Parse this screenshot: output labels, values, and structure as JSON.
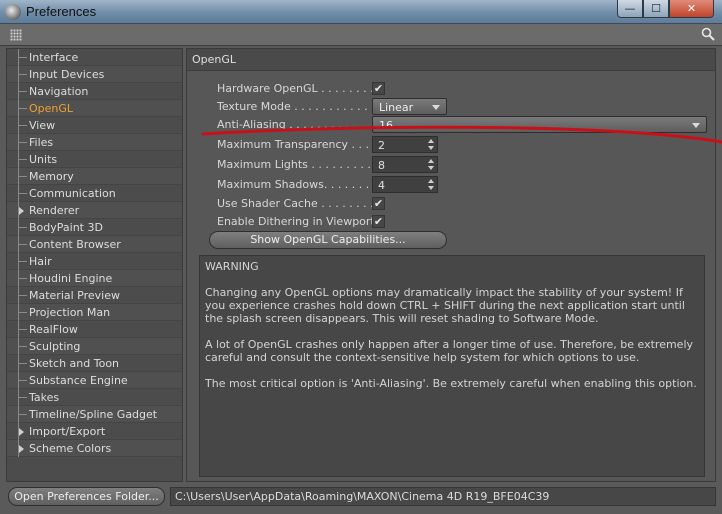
{
  "window": {
    "title": "Preferences",
    "close_glyph": "✕",
    "max_glyph": "☐",
    "min_glyph": "—"
  },
  "sidebar": {
    "items": [
      {
        "label": "Interface",
        "arrow": false,
        "active": false
      },
      {
        "label": "Input Devices",
        "arrow": false,
        "active": false
      },
      {
        "label": "Navigation",
        "arrow": false,
        "active": false
      },
      {
        "label": "OpenGL",
        "arrow": false,
        "active": true
      },
      {
        "label": "View",
        "arrow": false,
        "active": false
      },
      {
        "label": "Files",
        "arrow": false,
        "active": false
      },
      {
        "label": "Units",
        "arrow": false,
        "active": false
      },
      {
        "label": "Memory",
        "arrow": false,
        "active": false
      },
      {
        "label": "Communication",
        "arrow": false,
        "active": false
      },
      {
        "label": "Renderer",
        "arrow": true,
        "active": false
      },
      {
        "label": "BodyPaint 3D",
        "arrow": false,
        "active": false
      },
      {
        "label": "Content Browser",
        "arrow": false,
        "active": false
      },
      {
        "label": "Hair",
        "arrow": false,
        "active": false
      },
      {
        "label": "Houdini Engine",
        "arrow": false,
        "active": false
      },
      {
        "label": "Material Preview",
        "arrow": false,
        "active": false
      },
      {
        "label": "Projection Man",
        "arrow": false,
        "active": false
      },
      {
        "label": "RealFlow",
        "arrow": false,
        "active": false
      },
      {
        "label": "Sculpting",
        "arrow": false,
        "active": false
      },
      {
        "label": "Sketch and Toon",
        "arrow": false,
        "active": false
      },
      {
        "label": "Substance Engine",
        "arrow": false,
        "active": false
      },
      {
        "label": "Takes",
        "arrow": false,
        "active": false
      },
      {
        "label": "Timeline/Spline Gadget",
        "arrow": false,
        "active": false
      },
      {
        "label": "Import/Export",
        "arrow": true,
        "active": false
      },
      {
        "label": "Scheme Colors",
        "arrow": true,
        "active": false
      }
    ]
  },
  "main": {
    "header": "OpenGL",
    "hardware_opengl": {
      "label": "Hardware OpenGL . . . . . . . . . .",
      "checked": true
    },
    "texture_mode": {
      "label": "Texture Mode . . . . . . . . . . . . .",
      "value": "Linear"
    },
    "anti_aliasing": {
      "label": "Anti-Aliasing . . . . . . . . . . . . .",
      "value": "16"
    },
    "max_transparency": {
      "label": "Maximum Transparency . . . . .",
      "value": "2"
    },
    "max_lights": {
      "label": "Maximum Lights . . . . . . . . . . .",
      "value": "8"
    },
    "max_shadows": {
      "label": "Maximum Shadows. . . . . . . . .",
      "value": "4"
    },
    "use_shader_cache": {
      "label": "Use Shader Cache . . . . . . . . . .",
      "checked": true
    },
    "enable_dithering": {
      "label": "Enable Dithering in Viewport",
      "checked": true
    },
    "check_glyph": "✔",
    "caps_button": "Show OpenGL Capabilities...",
    "warning": {
      "title": "WARNING",
      "p1": "Changing any OpenGL options may dramatically impact the stability of your system! If you experience crashes hold down CTRL + SHIFT during the next application start until the splash screen disappears. This will reset shading to Software Mode.",
      "p2": "A lot of OpenGL crashes only happen after a longer time of use. Therefore, be extremely careful and consult the context-sensitive help system for which options to use.",
      "p3": "The most critical option is 'Anti-Aliasing'. Be extremely careful when enabling this option."
    }
  },
  "bottom": {
    "open_folder_button": "Open Preferences Folder...",
    "path": "C:\\Users\\User\\AppData\\Roaming\\MAXON\\Cinema 4D R19_BFE04C39"
  },
  "colors": {
    "active_item": "#f0a030",
    "annotation_red": "#c8101a"
  }
}
